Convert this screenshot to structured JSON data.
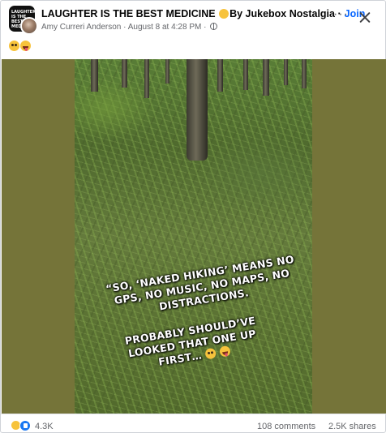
{
  "post": {
    "group_name": "LAUGHTER IS THE BEST MEDICINE",
    "by_text": "By Jukebox Nostalgia",
    "join_label": "Join",
    "author": "Amy Curreri Anderson",
    "date": "August 8 at 4:28 PM",
    "visibility_icon": "globe-icon",
    "avatar_text": "LAUGHTER IS THE BEST MEDICINE",
    "caption_emojis": [
      "flushed-face-emoji",
      "zany-face-emoji"
    ]
  },
  "media": {
    "overlay_line1": "“SO, ‘NAKED HIKING’ MEANS NO GPS, NO MUSIC, NO MAPS, NO DISTRACTIONS.",
    "overlay_line2": "PROBABLY SHOULD’VE LOOKED THAT ONE UP FIRST…"
  },
  "stats": {
    "reaction_count": "4.3K",
    "comments": "108 comments",
    "shares": "2.5K shares",
    "reaction_icons": [
      "haha-reaction-icon",
      "like-reaction-icon"
    ]
  },
  "colors": {
    "accent": "#0866ff",
    "media_bg": "#757439",
    "secondary_text": "#65676b"
  }
}
